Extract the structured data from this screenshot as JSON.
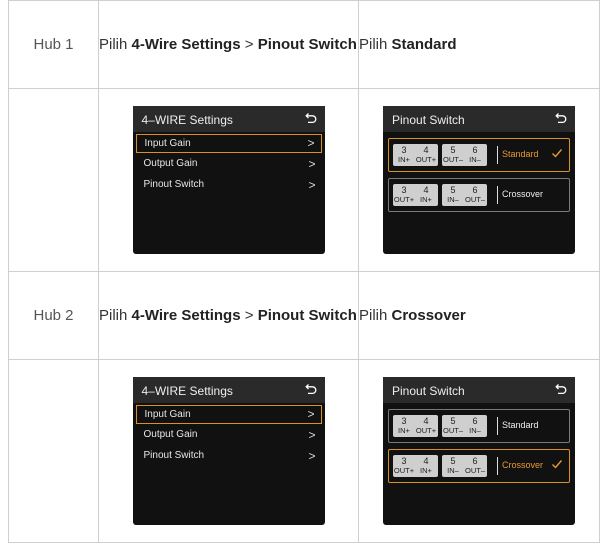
{
  "rows": [
    {
      "step": "Hub 1",
      "instr_a": {
        "prefix": "Pilih ",
        "bold1": "4-Wire Settings",
        "mid": " > ",
        "bold2": "Pinout Switch"
      },
      "instr_b": {
        "prefix": "Pilih ",
        "bold": "Standard"
      }
    },
    {
      "step": "Hub 2",
      "instr_a": {
        "prefix": "Pilih ",
        "bold1": "4-Wire Settings",
        "mid": " > ",
        "bold2": "Pinout Switch"
      },
      "instr_b": {
        "prefix": "Pilih ",
        "bold": "Crossover"
      }
    }
  ],
  "settings_screen": {
    "title": "4–WIRE Settings",
    "items": [
      "Input Gain",
      "Output Gain",
      "Pinout Switch"
    ],
    "selected_index": 0,
    "chevron": ">"
  },
  "pinout_screen": {
    "title": "Pinout Switch",
    "standard": {
      "label": "Standard",
      "left_box": {
        "n1": "3",
        "n2": "4",
        "s1": "IN+",
        "s2": "OUT+"
      },
      "right_box": {
        "n1": "5",
        "n2": "6",
        "s1": "OUT–",
        "s2": "IN–"
      }
    },
    "crossover": {
      "label": "Crossover",
      "left_box": {
        "n1": "3",
        "n2": "4",
        "s1": "OUT+",
        "s2": "IN+"
      },
      "right_box": {
        "n1": "5",
        "n2": "6",
        "s1": "IN–",
        "s2": "OUT–"
      }
    }
  },
  "colors": {
    "accent": "#d9902b",
    "screen_bg": "#111111",
    "border": "#cfcfcf"
  },
  "icons": {
    "back": "back-arrow-icon",
    "check": "check-icon",
    "chevron": "chevron-right-icon"
  }
}
